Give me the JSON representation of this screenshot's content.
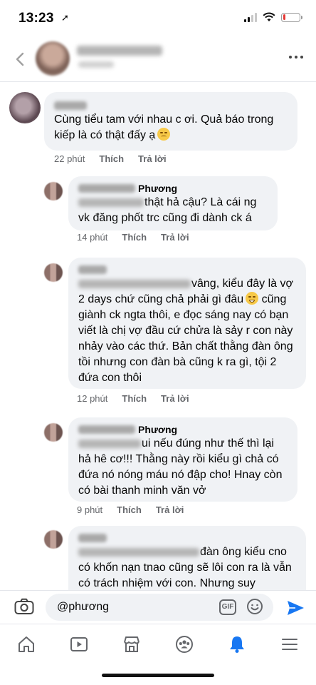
{
  "status_bar": {
    "time": "13:23",
    "location_glyph": "➚",
    "battery_level": 0.15,
    "battery_color": "#e53935"
  },
  "header": {
    "back_icon": "chevron-left-icon",
    "more_icon": "more-horizontal-icon"
  },
  "comments": [
    {
      "kind": "comment",
      "text": "Cùng tiểu tam với nhau c ơi. Quả báo trong kiếp là có thật đấy ạ",
      "emoji": "pensive-face",
      "time": "22 phút",
      "like_label": "Thích",
      "reply_label": "Trả lời"
    },
    {
      "kind": "reply",
      "name_suffix": "Phương",
      "text": "thật hả cậu? Là cái ng vk đăng phốt trc cũng đi dành ck á",
      "time": "14 phút",
      "like_label": "Thích",
      "reply_label": "Trả lời"
    },
    {
      "kind": "reply",
      "text": "vâng, kiểu đây là vợ 2 days chứ cũng chả phải gì đâu",
      "text_cont": "cũng giành ck ngta thôi, e đọc sáng nay có bạn viết là chị vợ đầu cứ chửa là sảy r con này nhảy vào các thứ. Bản chất thằng đàn ông tồi nhưng con đàn bà cũng k ra gì, tội 2 đứa con thôi",
      "emoji": "grinning-sweat-face",
      "time": "12 phút",
      "like_label": "Thích",
      "reply_label": "Trả lời"
    },
    {
      "kind": "reply",
      "name_suffix": "Phương",
      "text": "ui nếu đúng như thế thì lại hả hê cơ!!! Thằng này rồi kiểu gì chả có đứa nó nóng máu nó đập cho! Hnay còn có bài thanh minh văn vở",
      "time": "9 phút",
      "like_label": "Thích",
      "reply_label": "Trả lời"
    },
    {
      "kind": "reply",
      "text": "đàn ông kiểu cno có khốn nạn tnao cũng sẽ lôi con ra là vẫn có trách nhiệm với con. Nhưng suy"
    }
  ],
  "composer": {
    "value": "@phương",
    "camera_icon": "camera-icon",
    "gif_label": "GIF",
    "emoji_icon": "smile-icon",
    "send_icon": "send-icon",
    "accent": "#1877f2"
  },
  "tab_bar": {
    "tabs": [
      "home",
      "watch",
      "marketplace",
      "groups",
      "notifications",
      "menu"
    ],
    "active": "notifications",
    "active_color": "#1877f2"
  }
}
